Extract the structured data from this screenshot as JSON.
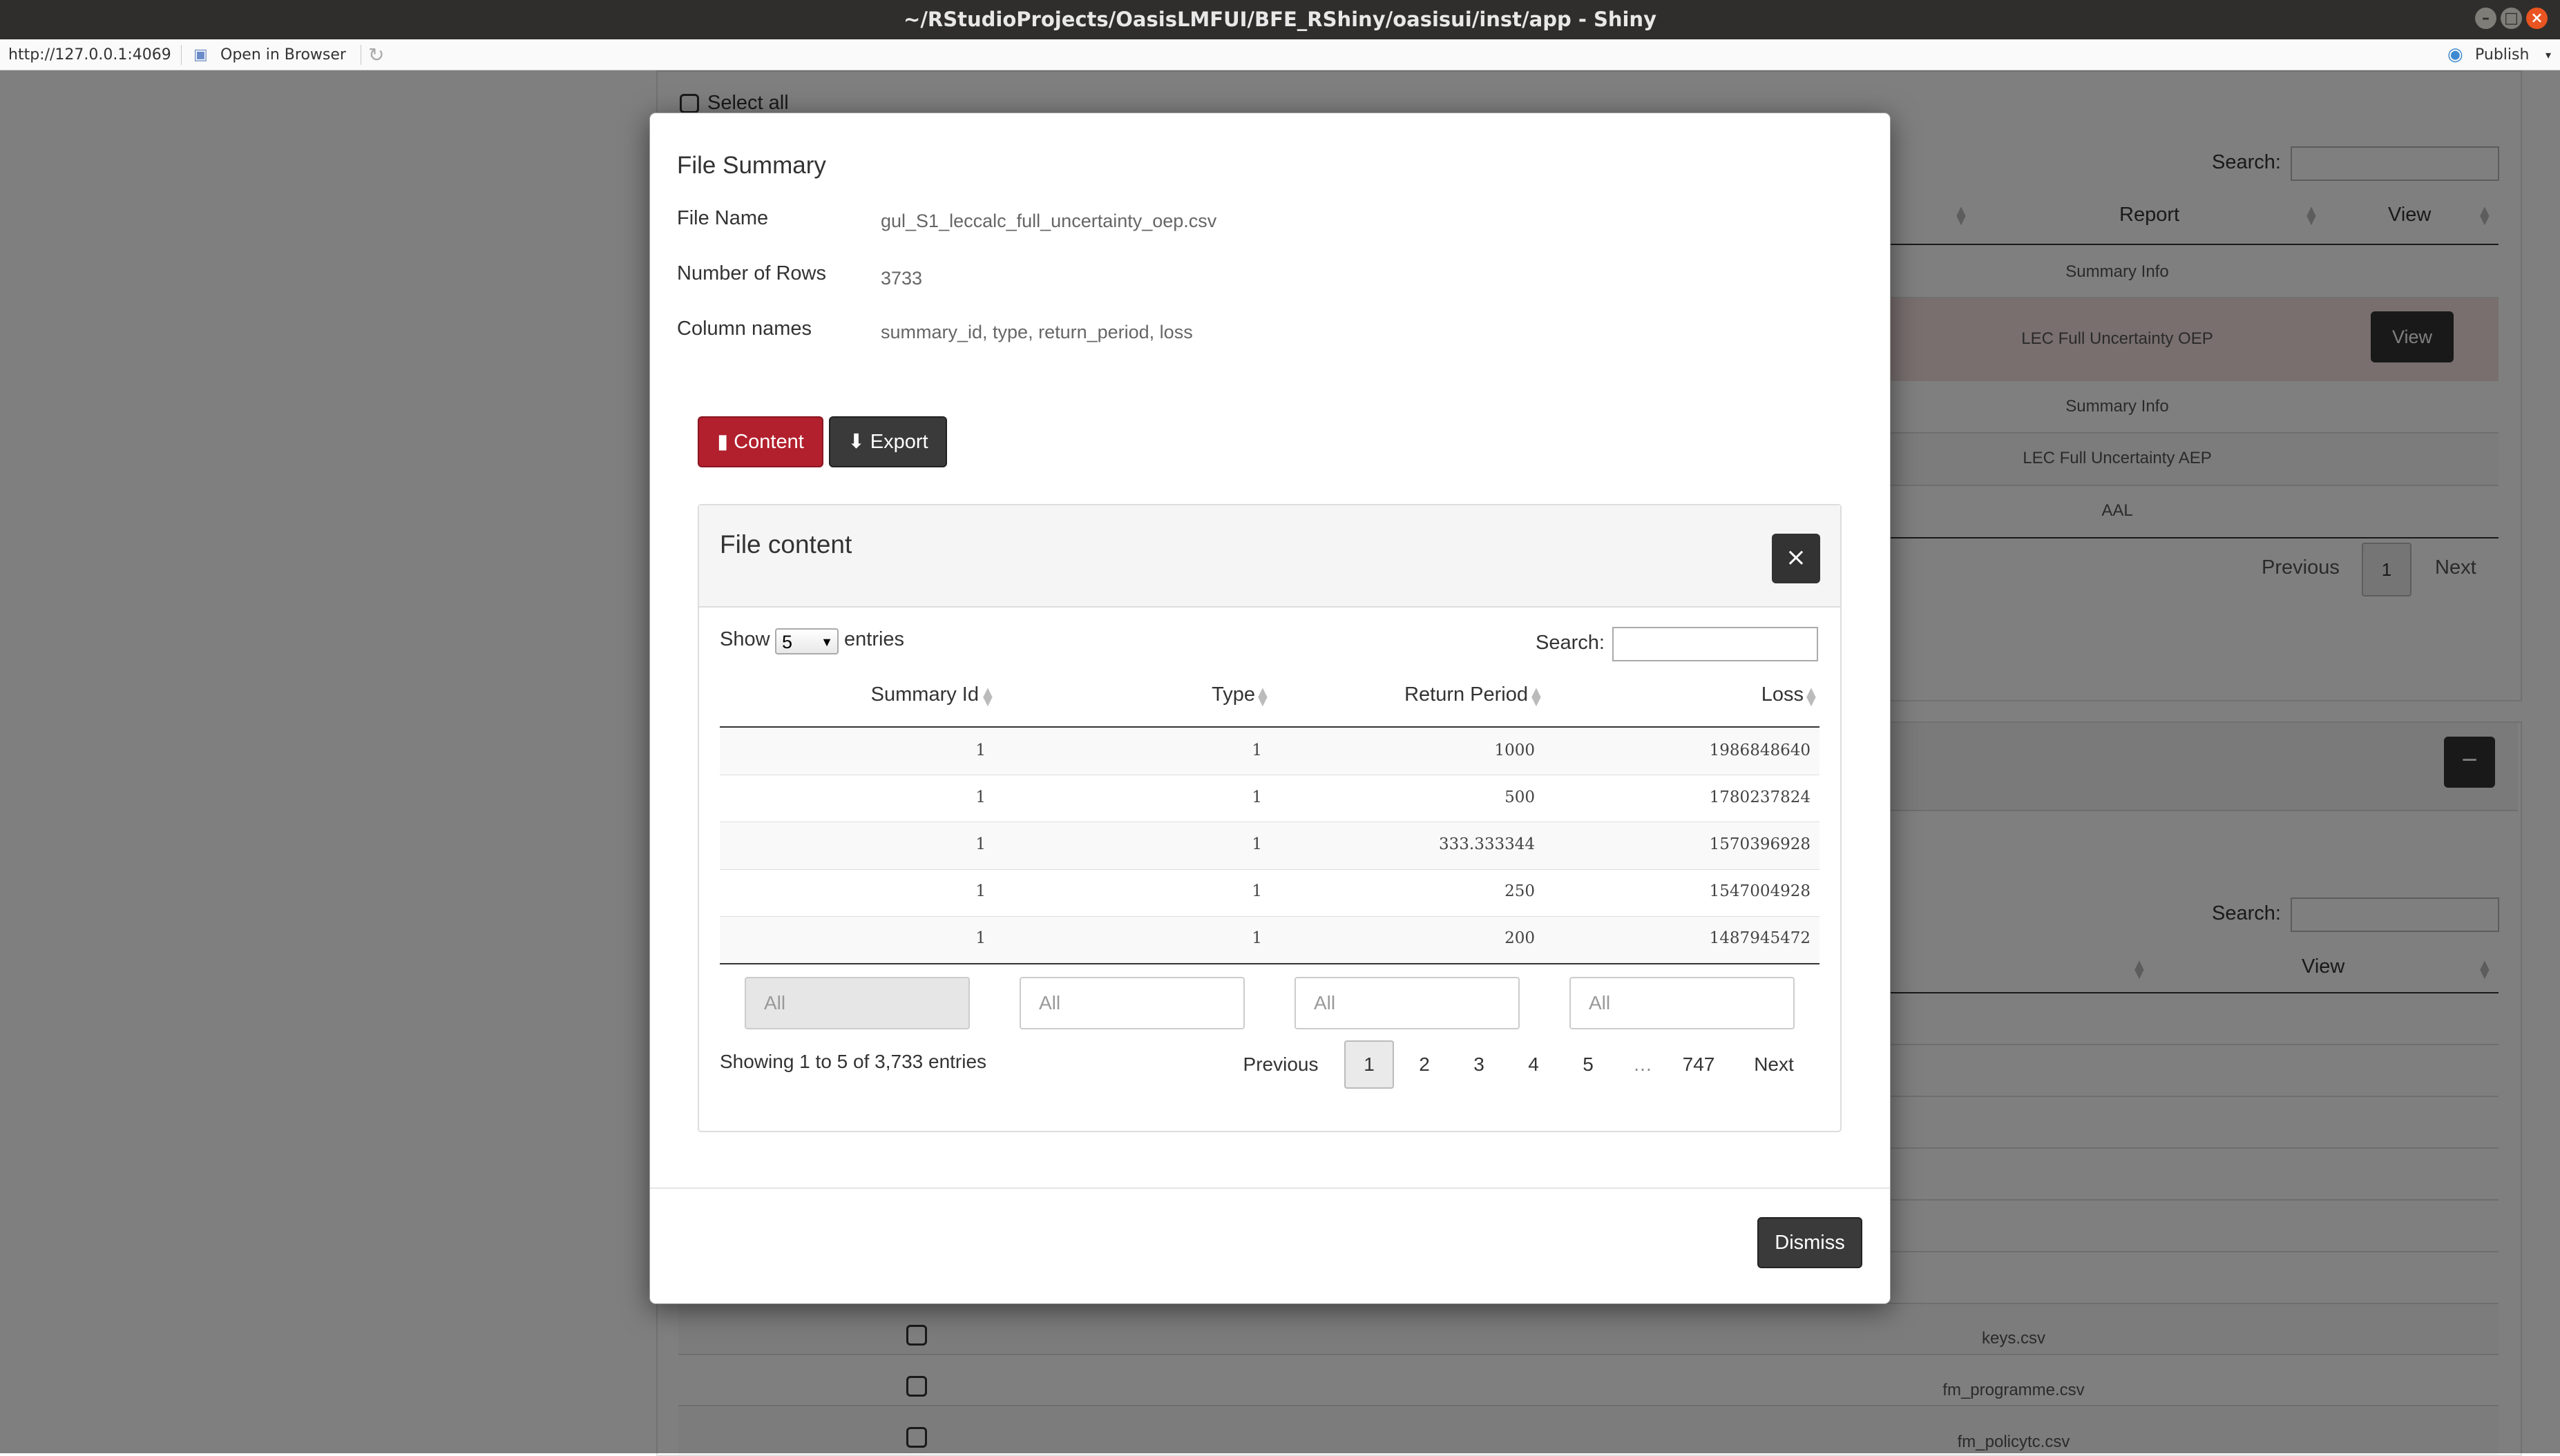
{
  "window": {
    "title": "~/RStudioProjects/OasisLMFUI/BFE_RShiny/oasisui/inst/app - Shiny"
  },
  "toolbar": {
    "url": "http://127.0.0.1:4069",
    "open_in_browser": "Open in Browser",
    "publish": "Publish"
  },
  "background": {
    "select_all": "Select all",
    "search_label": "Search:",
    "search_label_2": "Search:",
    "col_report": "Report",
    "col_view": "View",
    "col_view_2": "View",
    "reports": [
      "Summary Info",
      "LEC Full Uncertainty OEP",
      "Summary Info",
      "LEC Full Uncertainty AEP",
      "AAL"
    ],
    "view_button": "View",
    "pagination": {
      "previous": "Previous",
      "page": "1",
      "next": "Next"
    },
    "collapse_icon": "−",
    "files": [
      "keys.csv",
      "fm_programme.csv",
      "fm_policytc.csv"
    ]
  },
  "modal": {
    "title": "File Summary",
    "file_name_label": "File Name",
    "file_name_value": "gul_S1_leccalc_full_uncertainty_oep.csv",
    "rows_label": "Number of Rows",
    "rows_value": "3733",
    "columns_label": "Column names",
    "columns_value": "summary_id, type, return_period, loss",
    "content_button": "Content",
    "export_button": "Export",
    "dismiss_button": "Dismiss",
    "panel": {
      "title": "File content",
      "close_icon": "×",
      "show_label": "Show",
      "entries_value": "5",
      "entries_label": "entries",
      "search_label": "Search:",
      "columns": [
        "Summary Id",
        "Type",
        "Return Period",
        "Loss"
      ],
      "rows": [
        [
          "1",
          "1",
          "1000",
          "1986848640"
        ],
        [
          "1",
          "1",
          "500",
          "1780237824"
        ],
        [
          "1",
          "1",
          "333.333344",
          "1570396928"
        ],
        [
          "1",
          "1",
          "250",
          "1547004928"
        ],
        [
          "1",
          "1",
          "200",
          "1487945472"
        ]
      ],
      "filter_placeholder": "All",
      "info": "Showing 1 to 5 of 3,733 entries",
      "pagination": {
        "previous": "Previous",
        "pages": [
          "1",
          "2",
          "3",
          "4",
          "5"
        ],
        "ellipsis": "…",
        "last": "747",
        "next": "Next"
      }
    }
  }
}
